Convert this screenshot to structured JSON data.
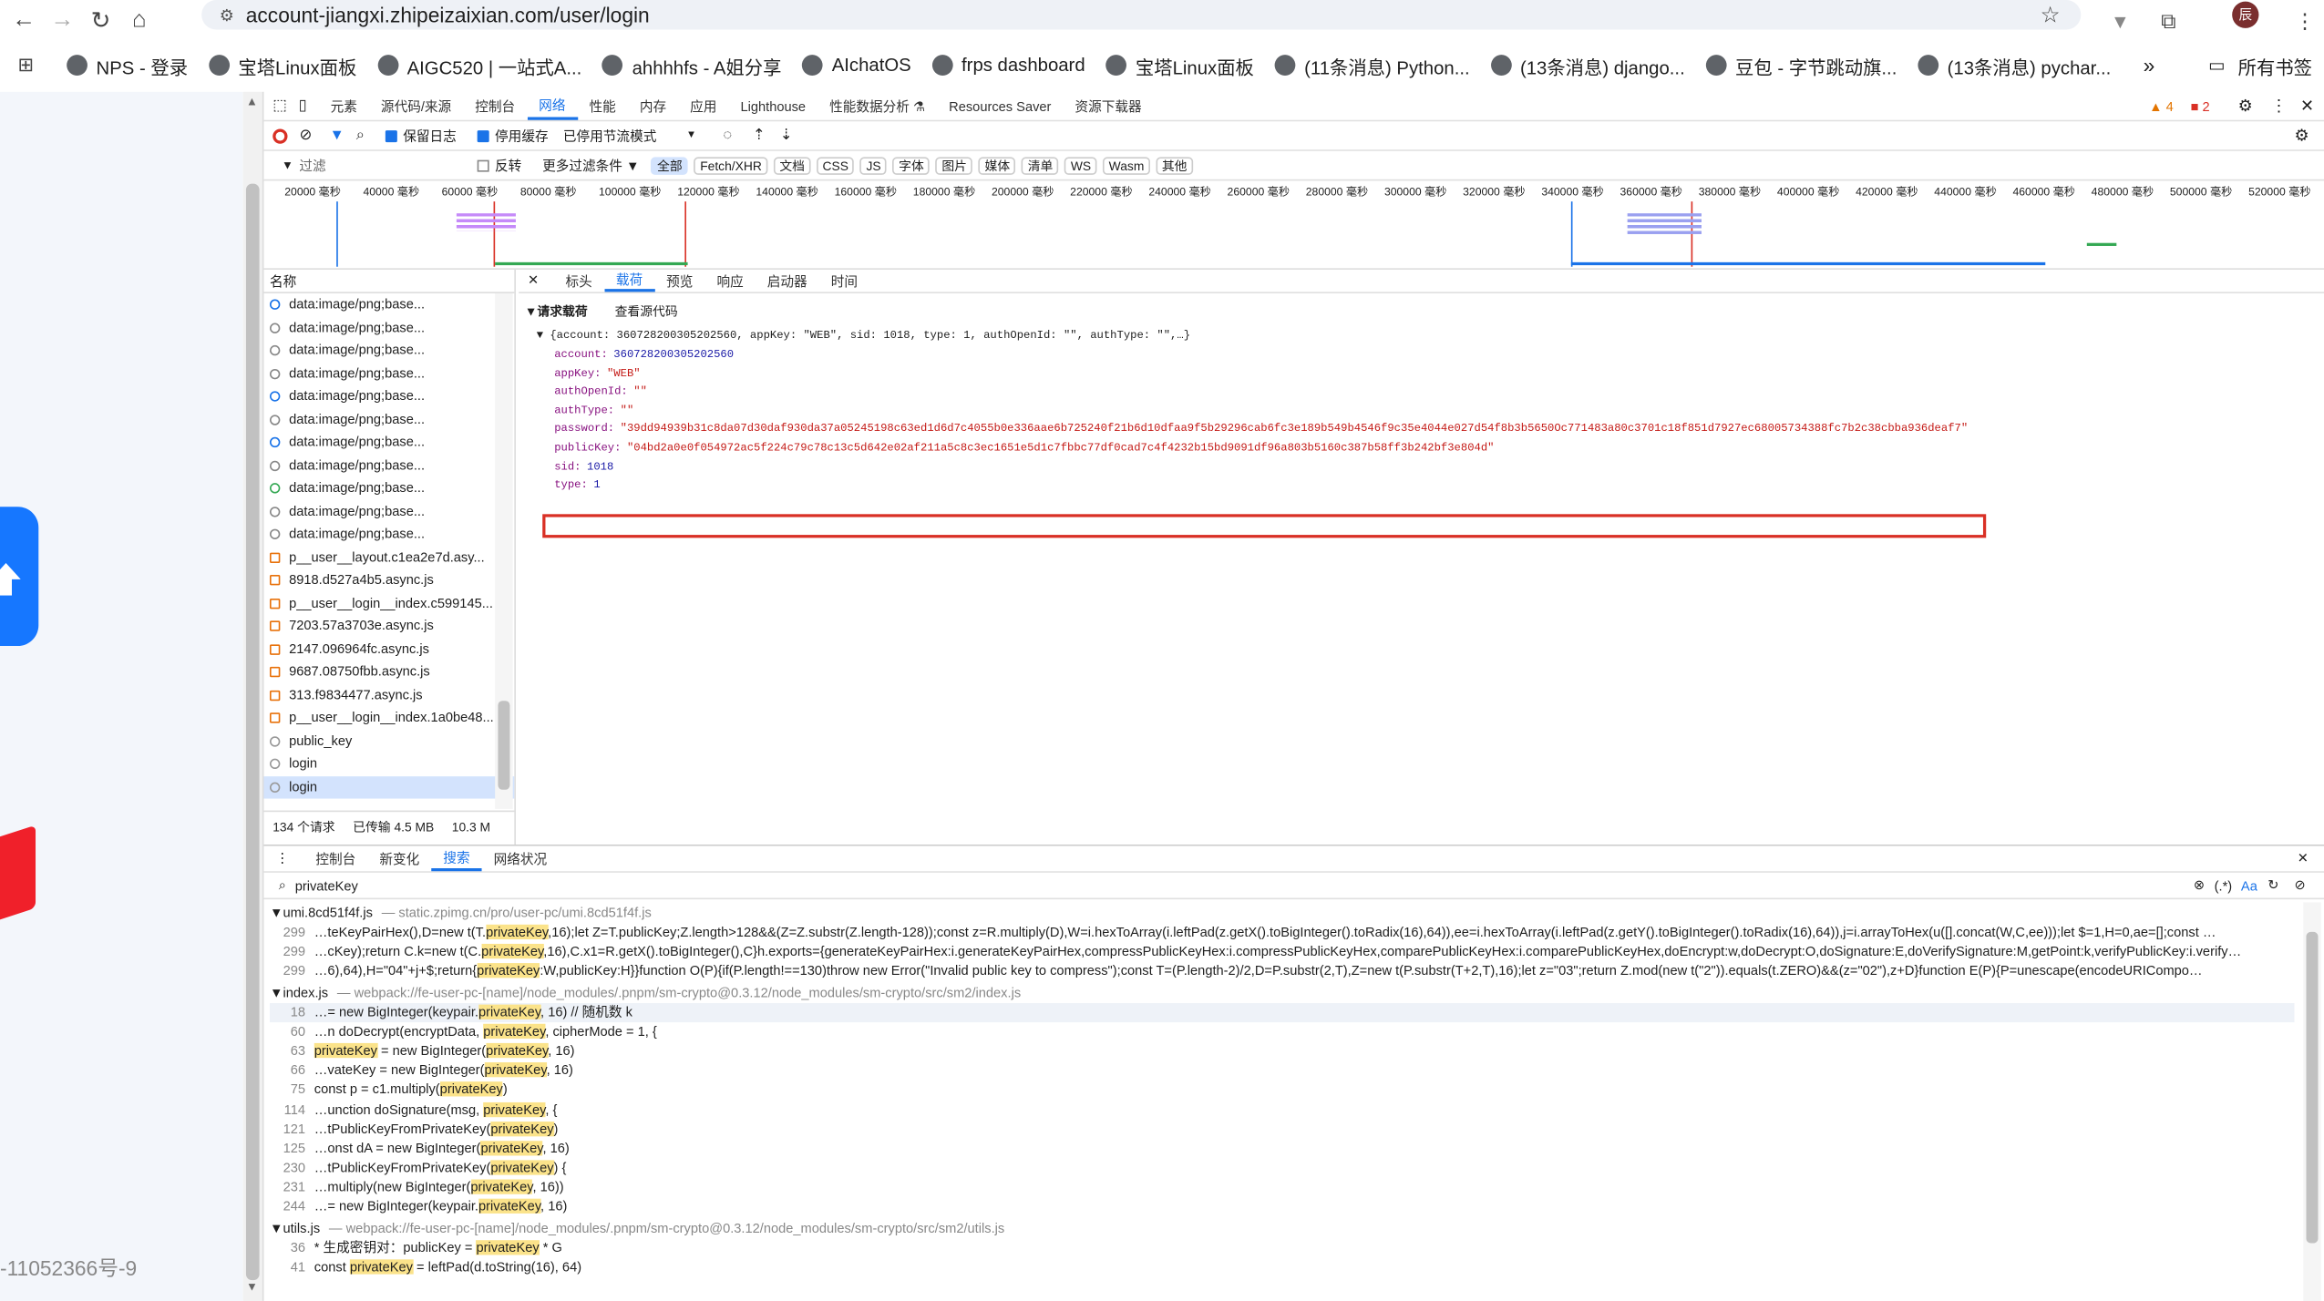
{
  "browser": {
    "url": "account-jiangxi.zhipeizaixian.com/user/login",
    "bookmarks": [
      "NPS - 登录",
      "宝塔Linux面板",
      "AIGC520 | 一站式A...",
      "ahhhhfs - A姐分享",
      "AIchatOS",
      "frps dashboard",
      "宝塔Linux面板",
      "(11条消息) Python...",
      "(13条消息) django...",
      "豆包 - 字节跳动旗...",
      "(13条消息) pychar..."
    ],
    "more": "»",
    "all_bookmarks": "所有书签",
    "profile": "辰"
  },
  "left_page": {
    "footer": "-11052366号-9"
  },
  "devtools": {
    "tabs": [
      "元素",
      "源代码/来源",
      "控制台",
      "网络",
      "性能",
      "内存",
      "应用",
      "Lighthouse",
      "性能数据分析 ⚗",
      "Resources Saver",
      "资源下载器"
    ],
    "warn": "4",
    "err": "2",
    "toolbar": {
      "preserve_log": "保留日志",
      "disable_cache": "停用缓存",
      "throttle": "已停用节流模式"
    },
    "filter": {
      "placeholder": "过滤",
      "invert": "反转",
      "more_filters": "更多过滤条件 ▼",
      "types": [
        "全部",
        "Fetch/XHR",
        "文档",
        "CSS",
        "JS",
        "字体",
        "图片",
        "媒体",
        "清单",
        "WS",
        "Wasm",
        "其他"
      ]
    },
    "timeline_ticks": [
      "20000 毫秒",
      "40000 毫秒",
      "60000 毫秒",
      "80000 毫秒",
      "100000 毫秒",
      "120000 毫秒",
      "140000 毫秒",
      "160000 毫秒",
      "180000 毫秒",
      "200000 毫秒",
      "220000 毫秒",
      "240000 毫秒",
      "260000 毫秒",
      "280000 毫秒",
      "300000 毫秒",
      "320000 毫秒",
      "340000 毫秒",
      "360000 毫秒",
      "380000 毫秒",
      "400000 毫秒",
      "420000 毫秒",
      "440000 毫秒",
      "460000 毫秒",
      "480000 毫秒",
      "500000 毫秒",
      "520000 毫秒"
    ],
    "list_header": "名称",
    "requests": [
      "data:image/png;base...",
      "data:image/png;base...",
      "data:image/png;base...",
      "data:image/png;base...",
      "data:image/png;base...",
      "data:image/png;base...",
      "data:image/png;base...",
      "data:image/png;base...",
      "data:image/png;base...",
      "data:image/png;base...",
      "data:image/png;base...",
      "p__user__layout.c1ea2e7d.asy...",
      "8918.d527a4b5.async.js",
      "p__user__login__index.c599145...",
      "7203.57a3703e.async.js",
      "2147.096964fc.async.js",
      "9687.08750fbb.async.js",
      "313.f9834477.async.js",
      "p__user__login__index.1a0be48...",
      "public_key",
      "login",
      "login"
    ],
    "status": {
      "count": "134 个请求",
      "transferred": "已传输 4.5 MB",
      "resources": "10.3 M"
    },
    "detail_tabs": [
      "标头",
      "载荷",
      "预览",
      "响应",
      "启动器",
      "时间"
    ],
    "payload": {
      "section": "▼请求载荷",
      "view_source": "查看源代码",
      "summary": "▼ {account: 360728200305202560, appKey: \"WEB\", sid: 1018, type: 1, authOpenId: \"\", authType: \"\",…}",
      "fields": [
        {
          "k": "account:",
          "v": "360728200305202560"
        },
        {
          "k": "appKey:",
          "v": "\"WEB\""
        },
        {
          "k": "authOpenId:",
          "v": "\"\""
        },
        {
          "k": "authType:",
          "v": "\"\""
        },
        {
          "k": "password:",
          "v": "\"39dd94939b31c8da07d30daf930da37a05245198c63ed1d6d7c4055b0e336aae6b725240f21b6d10dfaa9f5b29296cab6fc3e189b549b4546f9c35e4044e027d54f8b3b5650Oc771483a80c3701c18f851d7927ec68005734388fc7b2c38cbba936deaf7\""
        },
        {
          "k": "publicKey:",
          "v": "\"04bd2a0e0f054972ac5f224c79c78c13c5d642e02af211a5c8c3ec1651e5d1c7fbbc77df0cad7c4f4232b15bd9091df96a803b5160c387b58ff3b242bf3e804d\""
        },
        {
          "k": "sid:",
          "v": "1018"
        },
        {
          "k": "type:",
          "v": "1"
        }
      ]
    },
    "drawer_tabs": [
      "控制台",
      "新变化",
      "搜索",
      "网络状况"
    ],
    "search_query": "privateKey",
    "results": [
      {
        "file": "▼umi.8cd51f4f.js",
        "path": "— static.zpimg.cn/pro/user-pc/umi.8cd51f4f.js",
        "lines": [
          {
            "n": "299",
            "t": "…teKeyPairHex(),D=new t(T.privateKey,16);let Z=T.publicKey;Z.length>128&&(Z=Z.substr(Z.length-128));const z=R.multiply(D),W=i.hexToArray(i.leftPad(z.getX().toBigInteger().toRadix(16),64)),ee=i.hexToArray(i.leftPad(z.getY().toBigInteger().toRadix(16),64)),j=i.arrayToHex(u([].concat(W,C,ee)));let $=1,H=0,ae=[];const …"
          },
          {
            "n": "299",
            "t": "…cKey);return C.k=new t(C.privateKey,16),C.x1=R.getX().toBigInteger(),C}h.exports={generateKeyPairHex:i.generateKeyPairHex,compressPublicKeyHex:i.compressPublicKeyHex,comparePublicKeyHex:i.comparePublicKeyHex,doEncrypt:w,doDecrypt:O,doSignature:E,doVerifySignature:M,getPoint:k,verifyPublicKey:i.verify…"
          },
          {
            "n": "299",
            "t": "…6),64),H=\"04\"+j+$;return{privateKey:W,publicKey:H}}function O(P){if(P.length!==130)throw new Error(\"Invalid public key to compress\");const T=(P.length-2)/2,D=P.substr(2,T),Z=new t(P.substr(T+2,T),16);let z=\"03\";return Z.mod(new t(\"2\")).equals(t.ZERO)&&(z=\"02\"),z+D}function E(P){P=unescape(encodeURICompo…"
          }
        ]
      },
      {
        "file": "▼index.js",
        "path": "— webpack://fe-user-pc-[name]/node_modules/.pnpm/sm-crypto@0.3.12/node_modules/sm-crypto/src/sm2/index.js",
        "lines": [
          {
            "n": "18",
            "t": "…= new BigInteger(keypair.privateKey, 16) // 随机数 k"
          },
          {
            "n": "60",
            "t": "…n doDecrypt(encryptData, privateKey, cipherMode = 1, {"
          },
          {
            "n": "63",
            "t": "privateKey = new BigInteger(privateKey, 16)"
          },
          {
            "n": "66",
            "t": "…vateKey = new BigInteger(privateKey, 16)"
          },
          {
            "n": "75",
            "t": "const p = c1.multiply(privateKey)"
          },
          {
            "n": "114",
            "t": "…unction doSignature(msg, privateKey, {"
          },
          {
            "n": "121",
            "t": "…tPublicKeyFromPrivateKey(privateKey)"
          },
          {
            "n": "125",
            "t": "…onst dA = new BigInteger(privateKey, 16)"
          },
          {
            "n": "230",
            "t": "…tPublicKeyFromPrivateKey(privateKey) {"
          },
          {
            "n": "231",
            "t": "…multiply(new BigInteger(privateKey, 16))"
          },
          {
            "n": "244",
            "t": "…= new BigInteger(keypair.privateKey, 16)"
          }
        ]
      },
      {
        "file": "▼utils.js",
        "path": "— webpack://fe-user-pc-[name]/node_modules/.pnpm/sm-crypto@0.3.12/node_modules/sm-crypto/src/sm2/utils.js",
        "lines": [
          {
            "n": "36",
            "t": "* 生成密钥对：publicKey = privateKey * G"
          },
          {
            "n": "41",
            "t": "const privateKey = leftPad(d.toString(16), 64)"
          }
        ]
      }
    ]
  }
}
